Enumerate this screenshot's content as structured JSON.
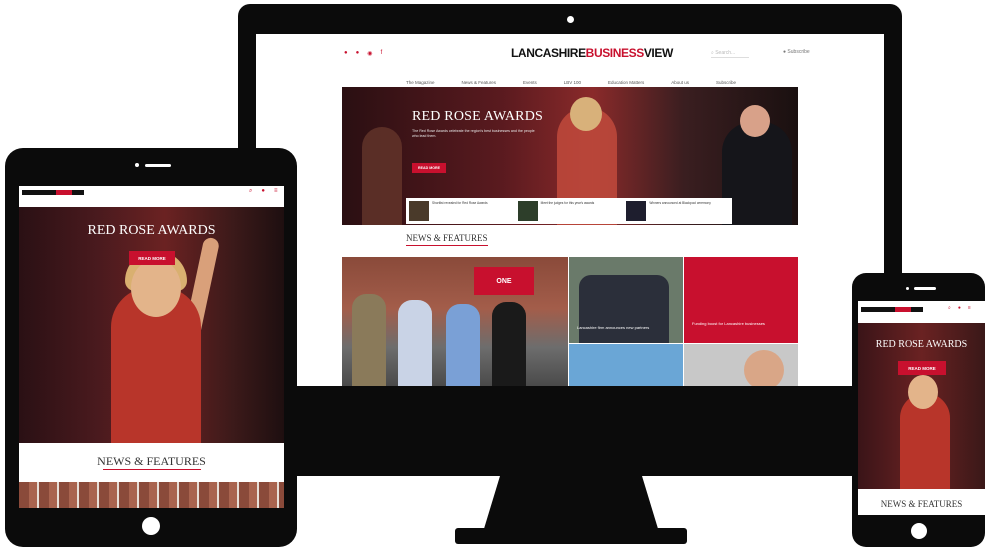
{
  "desktop": {
    "logo_left": "LANCASHIRE",
    "logo_mid": "BUSINESS",
    "logo_right": "VIEW",
    "social_icons": [
      "twitter-icon",
      "linkedin-icon",
      "instagram-icon",
      "facebook-icon"
    ],
    "search_placeholder": "Search...",
    "login_label": "Subscribe",
    "nav": [
      "The Magazine",
      "News & Features",
      "Events",
      "LBV 100",
      "Education Matters",
      "About us",
      "Subscribe"
    ],
    "hero": {
      "title": "RED ROSE AWARDS",
      "text": "The Red Rose Awards celebrate the region's best businesses and the people who lead them.",
      "button": "READ MORE"
    },
    "cards": [
      {
        "text": "Shortlist revealed for Red Rose Awards"
      },
      {
        "text": "Meet the judges for this year's awards"
      },
      {
        "text": "Winners announced at Blackpool ceremony"
      }
    ],
    "section_title": "NEWS & FEATURES",
    "tiles": [
      {
        "sign": "ONE"
      },
      {
        "caption": "Lancashire firm announces new partners"
      },
      {
        "caption": "Funding boost for Lancashire businesses"
      }
    ]
  },
  "tablet": {
    "hero_title": "RED ROSE AWARDS",
    "hero_button": "READ MORE",
    "section_title": "NEWS & FEATURES",
    "icons": [
      "search-icon",
      "user-icon",
      "menu-icon"
    ]
  },
  "phone": {
    "hero_title": "RED ROSE AWARDS",
    "hero_button": "READ MORE",
    "section_title": "NEWS & FEATURES",
    "icons": [
      "search-icon",
      "user-icon",
      "menu-icon"
    ]
  },
  "colors": {
    "brand_red": "#c8102e",
    "device_black": "#0b0b0b"
  }
}
